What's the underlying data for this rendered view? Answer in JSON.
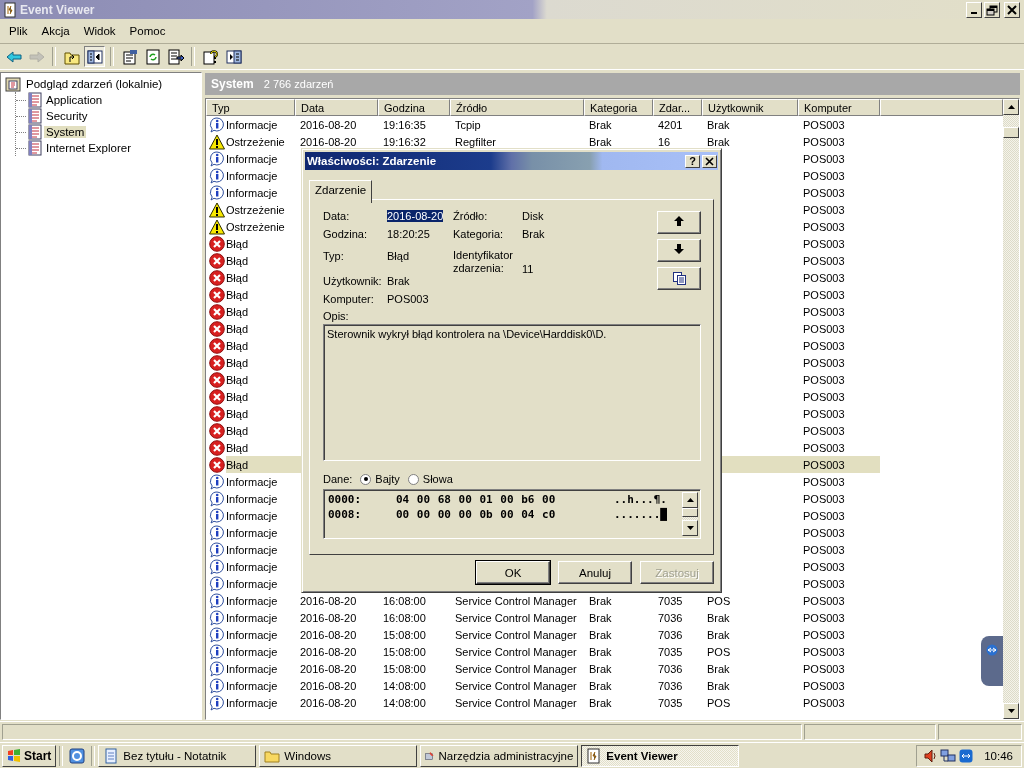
{
  "window": {
    "title": "Event Viewer"
  },
  "menu": [
    "Plik",
    "Akcja",
    "Widok",
    "Pomoc"
  ],
  "toolbar": [
    {
      "kind": "back",
      "disabled": false
    },
    {
      "kind": "forward",
      "disabled": true
    },
    {
      "kind": "sep"
    },
    {
      "kind": "up",
      "disabled": false
    },
    {
      "kind": "tree",
      "disabled": false,
      "pressed": true
    },
    {
      "kind": "sep"
    },
    {
      "kind": "properties",
      "disabled": false
    },
    {
      "kind": "refresh",
      "disabled": false
    },
    {
      "kind": "export",
      "disabled": false
    },
    {
      "kind": "sep"
    },
    {
      "kind": "help",
      "disabled": false
    },
    {
      "kind": "panel",
      "disabled": false
    }
  ],
  "tree": {
    "label": "Podgląd zdarzeń (lokalnie)",
    "children": [
      {
        "label": "Application",
        "selected": false
      },
      {
        "label": "Security",
        "selected": false
      },
      {
        "label": "System",
        "selected": true
      },
      {
        "label": "Internet Explorer",
        "selected": false
      }
    ]
  },
  "list_header": {
    "title": "System",
    "count": "2 766 zdarzeń"
  },
  "table": {
    "columns": [
      "Typ",
      "Data",
      "Godzina",
      "Źródło",
      "Kategoria",
      "Zdar...",
      "Użytkownik",
      "Komputer"
    ],
    "rows": [
      {
        "kind": "info",
        "type": "Informacje",
        "date": "2016-08-20",
        "time": "19:16:35",
        "source": "Tcpip",
        "category": "Brak",
        "event": "4201",
        "user": "Brak",
        "computer": "POS003",
        "selected": false
      },
      {
        "kind": "warning",
        "type": "Ostrzeżenie",
        "date": "2016-08-20",
        "time": "19:16:32",
        "source": "Regfilter",
        "category": "Brak",
        "event": "16",
        "user": "Brak",
        "computer": "POS003",
        "selected": false
      },
      {
        "kind": "info",
        "type": "Informacje",
        "computer": "POS003",
        "selected": false
      },
      {
        "kind": "info",
        "type": "Informacje",
        "computer": "POS003",
        "selected": false
      },
      {
        "kind": "info",
        "type": "Informacje",
        "computer": "POS003",
        "selected": false
      },
      {
        "kind": "warning",
        "type": "Ostrzeżenie",
        "computer": "POS003",
        "selected": false
      },
      {
        "kind": "warning",
        "type": "Ostrzeżenie",
        "computer": "POS003",
        "selected": false
      },
      {
        "kind": "error",
        "type": "Błąd",
        "computer": "POS003",
        "selected": false
      },
      {
        "kind": "error",
        "type": "Błąd",
        "computer": "POS003",
        "selected": false
      },
      {
        "kind": "error",
        "type": "Błąd",
        "computer": "POS003",
        "selected": false
      },
      {
        "kind": "error",
        "type": "Błąd",
        "computer": "POS003",
        "selected": false
      },
      {
        "kind": "error",
        "type": "Błąd",
        "computer": "POS003",
        "selected": false
      },
      {
        "kind": "error",
        "type": "Błąd",
        "computer": "POS003",
        "selected": false
      },
      {
        "kind": "error",
        "type": "Błąd",
        "computer": "POS003",
        "selected": false
      },
      {
        "kind": "error",
        "type": "Błąd",
        "computer": "POS003",
        "selected": false
      },
      {
        "kind": "error",
        "type": "Błąd",
        "computer": "POS003",
        "selected": false
      },
      {
        "kind": "error",
        "type": "Błąd",
        "computer": "POS003",
        "selected": false
      },
      {
        "kind": "error",
        "type": "Błąd",
        "computer": "POS003",
        "selected": false
      },
      {
        "kind": "error",
        "type": "Błąd",
        "computer": "POS003",
        "selected": false
      },
      {
        "kind": "error",
        "type": "Błąd",
        "computer": "POS003",
        "selected": false
      },
      {
        "kind": "error",
        "type": "Błąd",
        "computer": "POS003",
        "selected": true
      },
      {
        "kind": "info",
        "type": "Informacje",
        "computer": "POS003",
        "selected": false
      },
      {
        "kind": "info",
        "type": "Informacje",
        "computer": "POS003",
        "selected": false
      },
      {
        "kind": "info",
        "type": "Informacje",
        "computer": "POS003",
        "selected": false
      },
      {
        "kind": "info",
        "type": "Informacje",
        "computer": "POS003",
        "selected": false
      },
      {
        "kind": "info",
        "type": "Informacje",
        "computer": "POS003",
        "selected": false
      },
      {
        "kind": "info",
        "type": "Informacje",
        "computer": "POS003",
        "selected": false
      },
      {
        "kind": "info",
        "type": "Informacje",
        "computer": "POS003",
        "selected": false
      },
      {
        "kind": "info",
        "type": "Informacje",
        "date": "2016-08-20",
        "time": "16:08:00",
        "source": "Service Control Manager",
        "category": "Brak",
        "event": "7035",
        "user": "POS",
        "computer": "POS003",
        "selected": false
      },
      {
        "kind": "info",
        "type": "Informacje",
        "date": "2016-08-20",
        "time": "16:08:00",
        "source": "Service Control Manager",
        "category": "Brak",
        "event": "7036",
        "user": "Brak",
        "computer": "POS003",
        "selected": false
      },
      {
        "kind": "info",
        "type": "Informacje",
        "date": "2016-08-20",
        "time": "15:08:00",
        "source": "Service Control Manager",
        "category": "Brak",
        "event": "7036",
        "user": "Brak",
        "computer": "POS003",
        "selected": false
      },
      {
        "kind": "info",
        "type": "Informacje",
        "date": "2016-08-20",
        "time": "15:08:00",
        "source": "Service Control Manager",
        "category": "Brak",
        "event": "7035",
        "user": "POS",
        "computer": "POS003",
        "selected": false
      },
      {
        "kind": "info",
        "type": "Informacje",
        "date": "2016-08-20",
        "time": "15:08:00",
        "source": "Service Control Manager",
        "category": "Brak",
        "event": "7036",
        "user": "Brak",
        "computer": "POS003",
        "selected": false
      },
      {
        "kind": "info",
        "type": "Informacje",
        "date": "2016-08-20",
        "time": "14:08:00",
        "source": "Service Control Manager",
        "category": "Brak",
        "event": "7036",
        "user": "Brak",
        "computer": "POS003",
        "selected": false
      },
      {
        "kind": "info",
        "type": "Informacje",
        "date": "2016-08-20",
        "time": "14:08:00",
        "source": "Service Control Manager",
        "category": "Brak",
        "event": "7035",
        "user": "POS",
        "computer": "POS003",
        "selected": false
      }
    ]
  },
  "dialog": {
    "title": "Właściwości: Zdarzenie",
    "help_button": "?",
    "tabs": [
      {
        "label": "Zdarzenie",
        "selected": true
      }
    ],
    "fields": [
      {
        "label": "Data:",
        "value": "2016-08-20",
        "selected": true
      },
      {
        "label": "Źródło:",
        "value": "Disk",
        "selected": false
      },
      {
        "label": "Godzina:",
        "value": "18:20:25",
        "selected": false
      },
      {
        "label": "Kategoria:",
        "value": "Brak",
        "selected": false
      },
      {
        "label": "Typ:",
        "value": "Błąd",
        "selected": false
      },
      {
        "label": "Identyfikator zdarzenia:",
        "value": "11",
        "selected": false
      },
      {
        "label": "Użytkownik:",
        "value": "Brak",
        "selected": false
      },
      {
        "label": "Komputer:",
        "value": "POS003",
        "selected": false
      }
    ],
    "nav_buttons": [
      {
        "kind": "up"
      },
      {
        "kind": "down"
      },
      {
        "kind": "copy"
      }
    ],
    "description_label": "Opis:",
    "description": "Sterownik wykrył błąd kontrolera na \\Device\\Harddisk0\\D.",
    "data_label": "Dane:",
    "data_formats": [
      {
        "label": "Bajty",
        "selected": true
      },
      {
        "label": "Słowa",
        "selected": false
      }
    ],
    "hex_lines": [
      {
        "offset": "0000:",
        "bytes": "04 00 68 00 01 00 b6 00",
        "chars": "..h...¶."
      },
      {
        "offset": "0008:",
        "bytes": "00 00 00 00 0b 00 04 c0",
        "chars": ".......█"
      }
    ],
    "buttons": [
      {
        "label": "OK",
        "default": true,
        "disabled": false
      },
      {
        "label": "Anuluj",
        "default": false,
        "disabled": false
      },
      {
        "label": "Zastosuj",
        "default": false,
        "disabled": true
      }
    ]
  },
  "taskbar": {
    "start": "Start",
    "tasks": [
      {
        "label": "Bez tytułu - Notatnik",
        "kind": "notepad",
        "selected": false
      },
      {
        "label": "Windows",
        "kind": "folder",
        "selected": false
      },
      {
        "label": "Narzędzia administracyjne",
        "kind": "tools",
        "selected": false
      },
      {
        "label": "Event Viewer",
        "kind": "log",
        "selected": true
      }
    ],
    "clock": "10:46"
  }
}
